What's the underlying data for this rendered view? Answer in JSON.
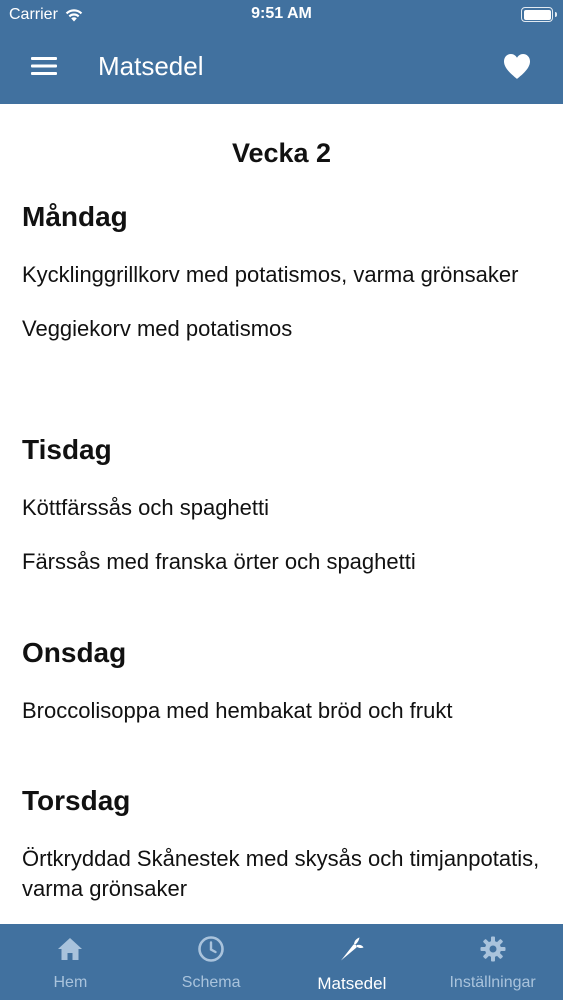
{
  "status_bar": {
    "carrier": "Carrier",
    "time": "9:51 AM"
  },
  "nav": {
    "title": "Matsedel",
    "menu_icon": "hamburger-icon",
    "favorite_icon": "heart-icon"
  },
  "week": {
    "title": "Vecka 2"
  },
  "days": [
    {
      "name": "Måndag",
      "dishes": [
        "Kycklinggrillkorv med potatismos, varma grönsaker",
        "Veggiekorv med potatismos"
      ]
    },
    {
      "name": "Tisdag",
      "dishes": [
        "Köttfärssås och spaghetti",
        "Färssås med franska örter och spaghetti"
      ]
    },
    {
      "name": "Onsdag",
      "dishes": [
        "Broccolisoppa med hembakat bröd och frukt"
      ]
    },
    {
      "name": "Torsdag",
      "dishes": [
        "Örtkryddad Skånestek med skysås och timjanpotatis, varma grönsaker"
      ]
    }
  ],
  "tabs": [
    {
      "label": "Hem",
      "icon": "home-icon",
      "active": false
    },
    {
      "label": "Schema",
      "icon": "clock-icon",
      "active": false
    },
    {
      "label": "Matsedel",
      "icon": "carrot-icon",
      "active": true
    },
    {
      "label": "Inställningar",
      "icon": "gear-icon",
      "active": false
    }
  ],
  "colors": {
    "primary": "#41719f",
    "inactive_tab": "#a9c3dc",
    "text": "#111111",
    "background": "#ffffff"
  }
}
